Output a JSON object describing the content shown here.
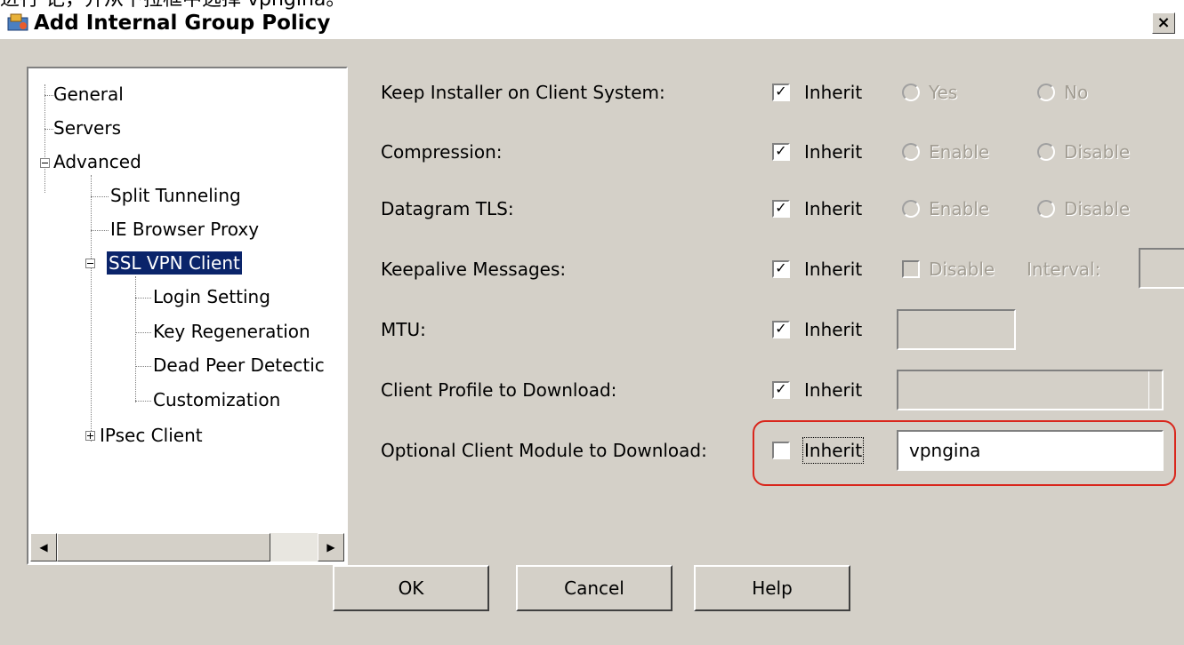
{
  "caption_text": "进行 记，并从下拉框中选择 vpngina。",
  "window": {
    "title": "Add Internal Group Policy",
    "close_label": "×"
  },
  "tree": {
    "general": "General",
    "servers": "Servers",
    "advanced": "Advanced",
    "split_tunneling": "Split Tunneling",
    "ie_browser_proxy": "IE Browser Proxy",
    "ssl_vpn_client": "SSL VPN Client",
    "login_setting": "Login Setting",
    "key_regeneration": "Key Regeneration",
    "dead_peer_detection": "Dead Peer Detectic",
    "customization": "Customization",
    "ipsec_client": "IPsec Client"
  },
  "form": {
    "keep_installer": {
      "label": "Keep Installer on Client System:",
      "inherit": "Inherit",
      "inherit_checked": true,
      "opt1": "Yes",
      "opt2": "No"
    },
    "compression": {
      "label": "Compression:",
      "inherit": "Inherit",
      "inherit_checked": true,
      "opt1": "Enable",
      "opt2": "Disable"
    },
    "datagram_tls": {
      "label": "Datagram TLS:",
      "inherit": "Inherit",
      "inherit_checked": true,
      "opt1": "Enable",
      "opt2": "Disable"
    },
    "keepalive": {
      "label": "Keepalive Messages:",
      "inherit": "Inherit",
      "inherit_checked": true,
      "disable": "Disable",
      "interval": "Interval:"
    },
    "mtu": {
      "label": "MTU:",
      "inherit": "Inherit",
      "inherit_checked": true,
      "value": ""
    },
    "client_profile": {
      "label": "Client Profile to Download:",
      "inherit": "Inherit",
      "inherit_checked": true,
      "value": ""
    },
    "optional_module": {
      "label": "Optional Client Module to Download:",
      "inherit": "Inherit",
      "inherit_checked": false,
      "value": "vpngina"
    }
  },
  "buttons": {
    "ok": "OK",
    "cancel": "Cancel",
    "help": "Help"
  },
  "colors": {
    "dialog_bg": "#d4d0c8",
    "selection": "#0a246a",
    "highlight_ring": "#d9261c"
  }
}
